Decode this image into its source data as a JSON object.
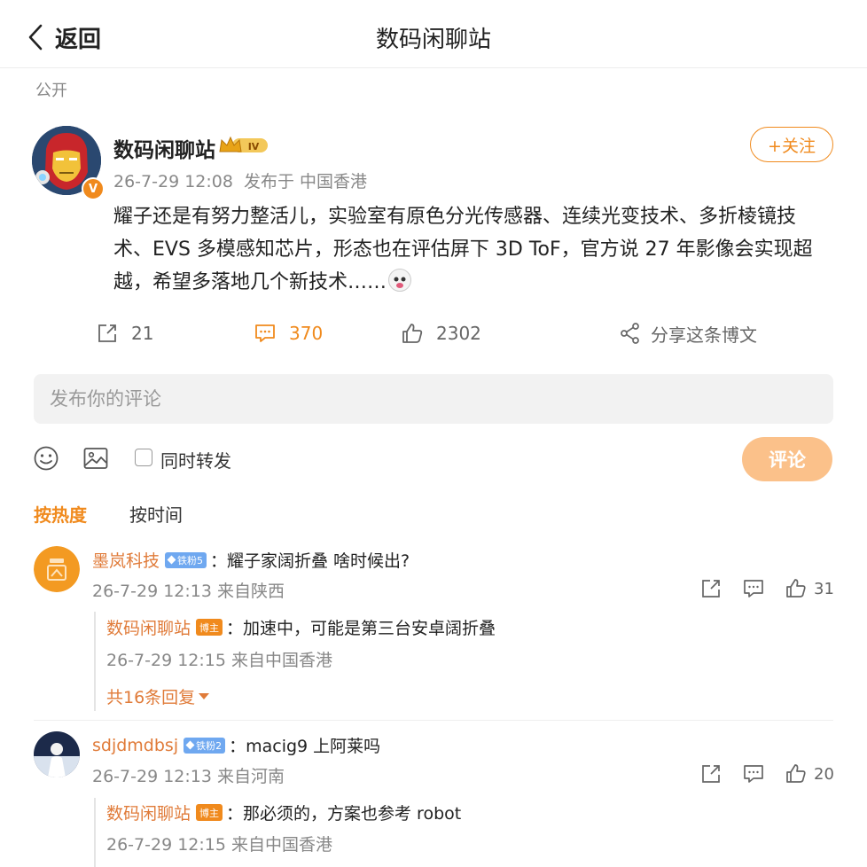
{
  "header": {
    "back_label": "返回",
    "title": "数码闲聊站"
  },
  "visibility": "公开",
  "post": {
    "author": "数码闲聊站",
    "verified_badge": "V",
    "time": "26-7-29 12:08",
    "source": "发布于 中国香港",
    "follow_label": "+关注",
    "text": "耀子还是有努力整活儿，实验室有原色分光传感器、连续光变技术、多折棱镜技术、EVS 多模感知芯片，形态也在评估屏下 3D ToF，官方说 27 年影像会实现超越，希望多落地几个新技术……",
    "reposts": "21",
    "comments": "370",
    "likes": "2302",
    "share_label": "分享这条博文"
  },
  "composer": {
    "placeholder": "发布你的评论",
    "repost_label": "同时转发",
    "submit_label": "评论"
  },
  "sort": {
    "hot": "按热度",
    "time": "按时间"
  },
  "comments": [
    {
      "user": "墨岚科技",
      "fan_badge": "铁粉5",
      "text": "：耀子家阔折叠 啥时候出?",
      "time": "26-7-29 12:13 来自陕西",
      "likes": "31",
      "reply": {
        "user": "数码闲聊站",
        "tag": "博主",
        "text": "：加速中，可能是第三台安卓阔折叠",
        "time": "26-7-29 12:15 来自中国香港"
      },
      "more_replies": "共16条回复"
    },
    {
      "user": "sdjdmdbsj",
      "fan_badge": "铁粉2",
      "text": "：macig9 上阿莱吗",
      "time": "26-7-29 12:13 来自河南",
      "likes": "20",
      "reply": {
        "user": "数码闲聊站",
        "tag": "博主",
        "text": "：那必须的，方案也参考 robot",
        "time": "26-7-29 12:15 来自中国香港"
      }
    }
  ],
  "colors": {
    "accent": "#f08a1d",
    "username": "#e07b39",
    "submit_disabled": "#fbc18a",
    "fan_badge": "#6fa8f0"
  }
}
